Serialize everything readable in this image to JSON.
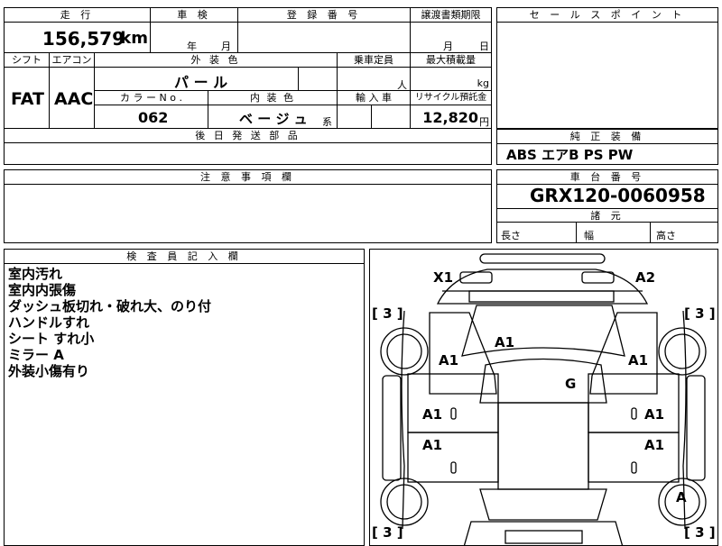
{
  "spec": {
    "mileage_header": "走 行",
    "mileage_value": "156,579",
    "mileage_unit": "km",
    "shaken_header": "車 検",
    "shaken_year": "年",
    "shaken_month": "月",
    "reg_header": "登 録 番 号",
    "transfer_header": "譲渡書類期限",
    "transfer_month": "月",
    "transfer_day": "日",
    "shift_header": "シフト",
    "shift_value": "FAT",
    "ac_header": "エアコン",
    "ac_value": "AAC",
    "exterior_header": "外 装 色",
    "exterior_value": "パ ー ル",
    "capacity_header": "乗車定員",
    "capacity_unit": "人",
    "load_header": "最大積載量",
    "load_unit": "kg",
    "color_no_header": "カ ラ ー N o .",
    "color_no_value": "062",
    "interior_header": "内 装 色",
    "interior_value": "ベ ー ジ ュ",
    "interior_suffix": "系",
    "import_header": "輸 入 車",
    "recycle_header": "リサイクル預託金",
    "recycle_value": "12,820",
    "recycle_unit": "円",
    "later_parts_header": "後 日 発 送 部 品"
  },
  "sales_point": {
    "header": "セ ー ル ス ポ イ ン ト"
  },
  "equipment": {
    "header": "純 正 装 備",
    "value": "ABS エアB PS PW"
  },
  "notes_section": {
    "header": "注 意 事 項 欄"
  },
  "chassis": {
    "header": "車 台 番 号",
    "value": "GRX120-0060958",
    "dims_header": "諸 元",
    "length": "長さ",
    "width": "幅",
    "height": "高さ"
  },
  "inspector": {
    "header": "検 査 員 記 入 欄",
    "notes": [
      "室内汚れ",
      "室内内張傷",
      "ダッシュ板切れ・破れ大、のり付",
      "ハンドルすれ",
      "シート すれ小",
      "ミラー A",
      "外装小傷有り"
    ]
  },
  "diagram": {
    "marks": {
      "front_left": "X1",
      "front_right": "A2",
      "windshield": "A1",
      "roof": "G",
      "front_fender_left": "A1",
      "front_fender_right": "A1",
      "front_door_left": "A1",
      "front_door_right": "A1",
      "rear_door_left": "A1",
      "rear_door_right": "A1",
      "rear_wheel_right": "A"
    },
    "tire_brackets": {
      "fl": "[ 3 ]",
      "fr": "[ 3 ]",
      "rl": "[ 3 ]",
      "rr": "[ 3 ]"
    }
  }
}
